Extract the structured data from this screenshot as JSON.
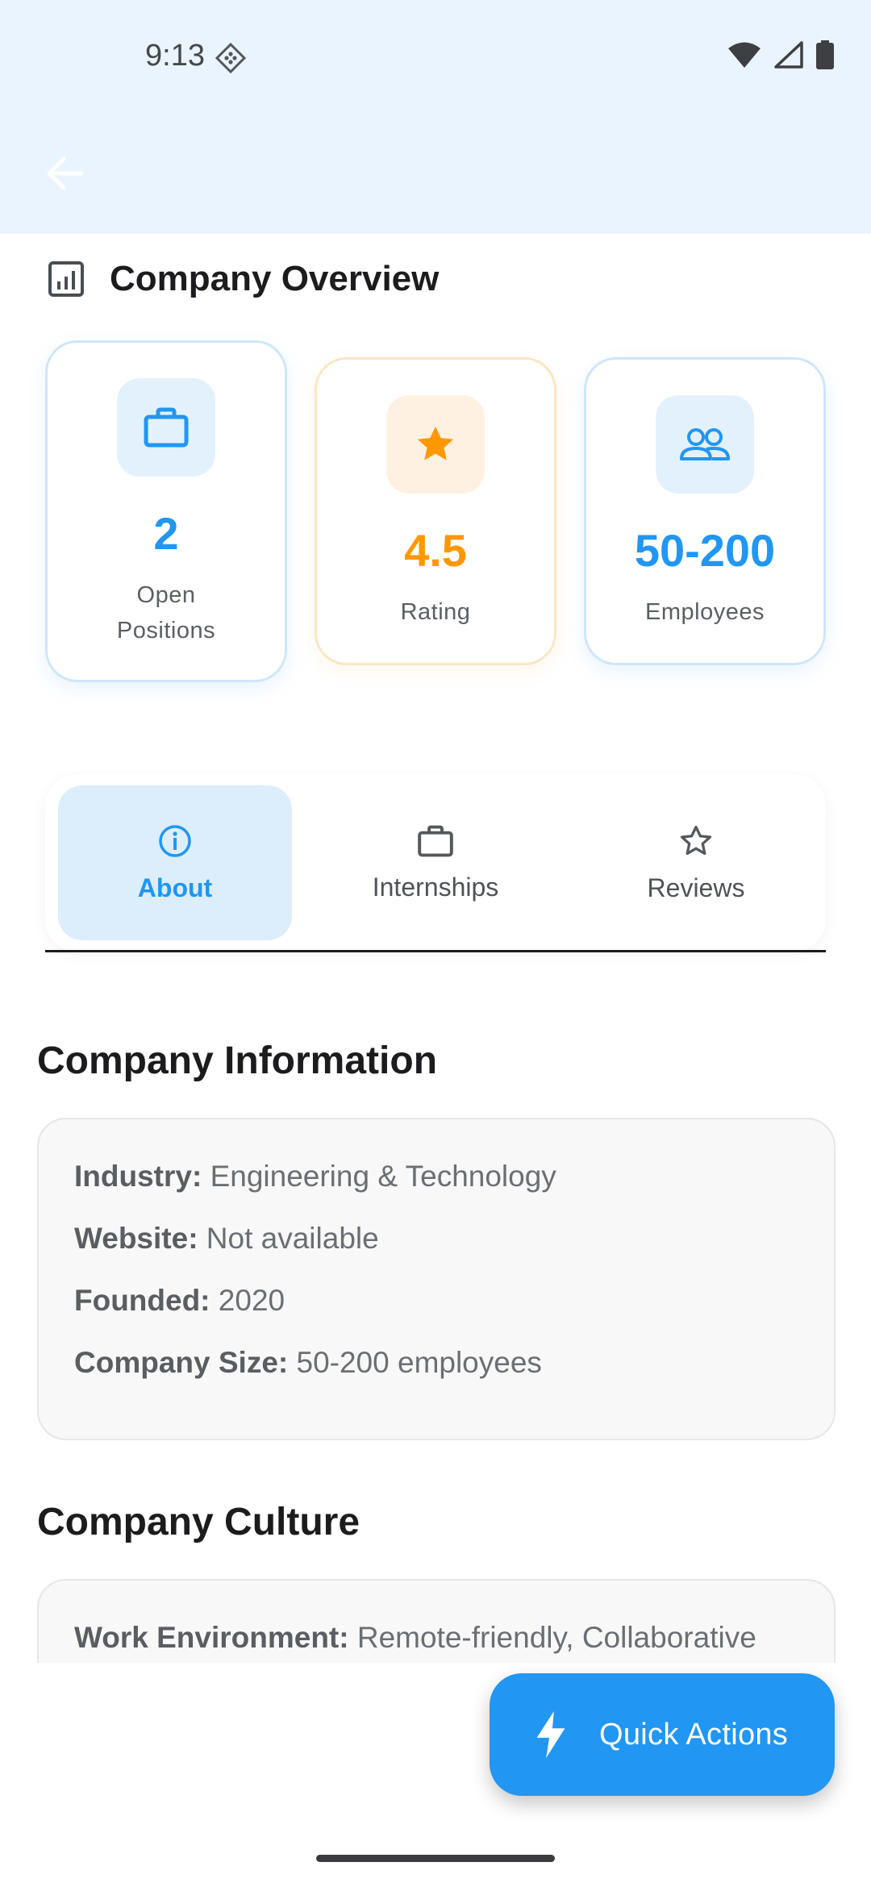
{
  "status_bar": {
    "time": "9:13"
  },
  "header": {
    "back_icon": "arrow-left-icon"
  },
  "overview": {
    "title": "Company Overview",
    "icon": "chart-icon",
    "stats": [
      {
        "value": "2",
        "label": "Open Positions",
        "icon": "briefcase-icon",
        "color": "#2196f3"
      },
      {
        "value": "4.5",
        "label": "Rating",
        "icon": "star-icon",
        "color": "#ff9800"
      },
      {
        "value": "50-200",
        "label": "Employees",
        "icon": "people-icon",
        "color": "#2196f3"
      }
    ]
  },
  "tabs": [
    {
      "label": "About",
      "icon": "info-icon",
      "active": true
    },
    {
      "label": "Internships",
      "icon": "briefcase-icon",
      "active": false
    },
    {
      "label": "Reviews",
      "icon": "star-outline-icon",
      "active": false
    }
  ],
  "company_info": {
    "title": "Company Information",
    "rows": [
      {
        "key": "Industry:",
        "value": "Engineering & Technology"
      },
      {
        "key": "Website:",
        "value": "Not available"
      },
      {
        "key": "Founded:",
        "value": "2020"
      },
      {
        "key": "Company Size:",
        "value": "50-200 employees"
      }
    ]
  },
  "company_culture": {
    "title": "Company Culture",
    "rows": [
      {
        "key": "Work Environment:",
        "value": "Remote-friendly, Collaborative"
      }
    ]
  },
  "fab": {
    "label": "Quick Actions",
    "icon": "bolt-icon"
  },
  "colors": {
    "accent": "#2196f3",
    "rating": "#ff9800",
    "header_bg": "#eaf4fe"
  }
}
